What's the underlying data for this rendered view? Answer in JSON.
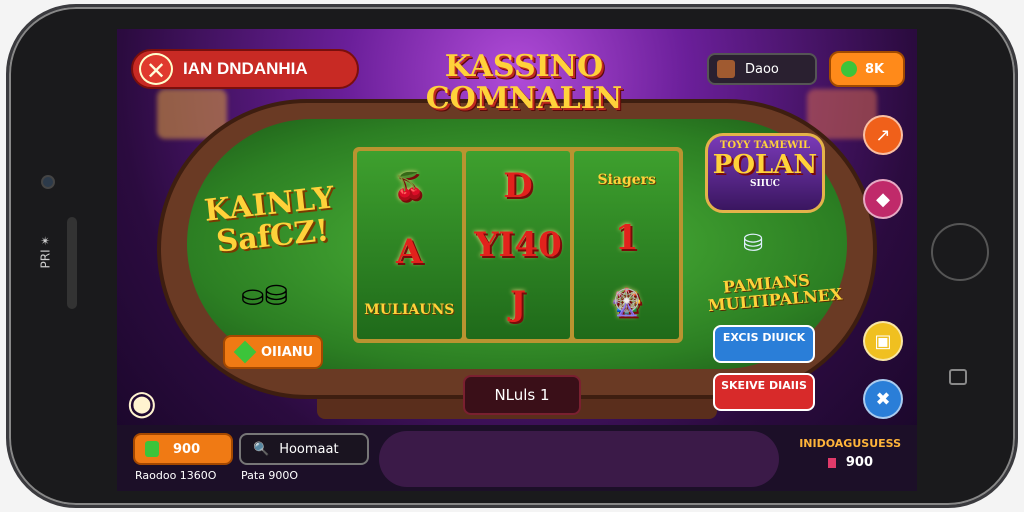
{
  "device": {
    "side_text": "PRІ ✴"
  },
  "header": {
    "close_glyph": "✕",
    "left_label": "IAN DNDANHIA",
    "title_line1": "KASSINO",
    "title_line2": "COMNALIN",
    "account_label": "Daoo",
    "top_coins_label": "8K"
  },
  "left_panel": {
    "banner": "KAINLY SafCZ!",
    "button_label": "OIIANU"
  },
  "reels": [
    {
      "symbols": [
        {
          "type": "icon",
          "text": "🍒"
        },
        {
          "type": "big",
          "text": "A"
        },
        {
          "type": "word",
          "text": "MULIAUNS"
        }
      ]
    },
    {
      "symbols": [
        {
          "type": "big",
          "text": "D"
        },
        {
          "type": "big",
          "text": "YI40"
        },
        {
          "type": "big",
          "text": "J"
        }
      ]
    },
    {
      "symbols": [
        {
          "type": "word",
          "text": "Siagers"
        },
        {
          "type": "big",
          "text": "1"
        },
        {
          "type": "icon",
          "text": "🎡"
        }
      ]
    }
  ],
  "right_panel": {
    "badge_top": "TOYY TAMEWIL",
    "badge_main": "POLAN",
    "badge_sub": "SIIUC",
    "promo_text": "PAMIANS MULTIPALNEX",
    "blue_button": "EXCIS DIUICK",
    "red_button": "SKEIVE DIAIIS"
  },
  "center_label": "NLuls 1",
  "bottom": {
    "balance_label": "900",
    "search_label": "Hoomaat",
    "caption_left": "Raodoo 1360O",
    "caption_mid": "Pata 900O",
    "right_label": "INIDOAGUSUESS",
    "right_value": "900"
  },
  "side_buttons": [
    {
      "name": "chart-icon",
      "glyph": "↗",
      "color": "#f0601a"
    },
    {
      "name": "gem-icon",
      "glyph": "◆",
      "color": "#c02a6a"
    },
    {
      "name": "trophy-icon",
      "glyph": "▣",
      "color": "#f0c020"
    },
    {
      "name": "settings-icon",
      "glyph": "✖",
      "color": "#2a7ed8"
    }
  ],
  "colors": {
    "felt": "#2c7f23",
    "rim": "#6a3a24",
    "accent": "#ffd23a",
    "orange": "#f07a14"
  }
}
